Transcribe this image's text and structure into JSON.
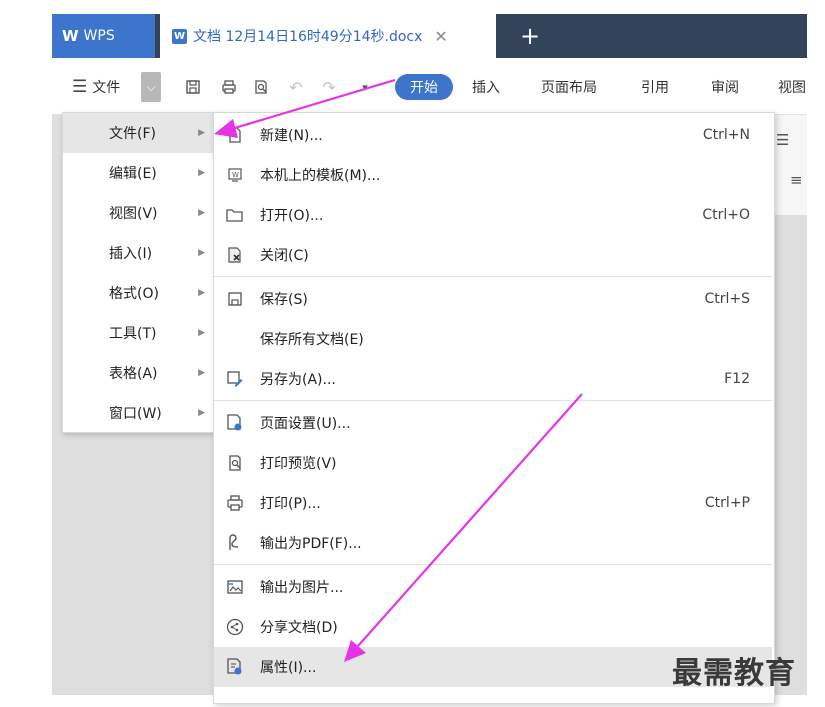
{
  "tabs": {
    "app": "WPS",
    "document": "文档 12月14日16时49分14秒.docx",
    "doc_icon_letter": "W",
    "close": "✕",
    "new": "+"
  },
  "toolbar": {
    "menu_icon": "☰",
    "file_label": "文件",
    "dropdown_icon": "⌵",
    "quick_icons": [
      "save-icon",
      "print-icon",
      "print-preview-icon",
      "undo-icon",
      "redo-icon",
      "customize-icon"
    ],
    "ribbon_tabs": [
      "开始",
      "插入",
      "页面布局",
      "引用",
      "审阅",
      "视图"
    ]
  },
  "left_menu": [
    {
      "label": "文件(F)",
      "active": true
    },
    {
      "label": "编辑(E)"
    },
    {
      "label": "视图(V)"
    },
    {
      "label": "插入(I)"
    },
    {
      "label": "格式(O)"
    },
    {
      "label": "工具(T)"
    },
    {
      "label": "表格(A)"
    },
    {
      "label": "窗口(W)"
    }
  ],
  "file_menu": [
    {
      "label": "新建(N)...",
      "shortcut": "Ctrl+N",
      "icon": "new-document-icon"
    },
    {
      "label": "本机上的模板(M)...",
      "shortcut": "",
      "icon": "template-icon"
    },
    {
      "label": "打开(O)...",
      "shortcut": "Ctrl+O",
      "icon": "open-folder-icon"
    },
    {
      "label": "关闭(C)",
      "shortcut": "",
      "icon": "close-document-icon"
    },
    {
      "label": "保存(S)",
      "shortcut": "Ctrl+S",
      "icon": "save-icon"
    },
    {
      "label": "保存所有文档(E)",
      "shortcut": "",
      "icon": ""
    },
    {
      "label": "另存为(A)...",
      "shortcut": "F12",
      "icon": "save-as-icon"
    },
    {
      "label": "页面设置(U)...",
      "shortcut": "",
      "icon": "page-setup-icon"
    },
    {
      "label": "打印预览(V)",
      "shortcut": "",
      "icon": "print-preview-icon"
    },
    {
      "label": "打印(P)...",
      "shortcut": "Ctrl+P",
      "icon": "print-icon"
    },
    {
      "label": "输出为PDF(F)...",
      "shortcut": "",
      "icon": "export-pdf-icon"
    },
    {
      "label": "输出为图片...",
      "shortcut": "",
      "icon": "export-image-icon"
    },
    {
      "label": "分享文档(D)",
      "shortcut": "",
      "icon": "share-icon"
    },
    {
      "label": "属性(I)...",
      "shortcut": "",
      "icon": "properties-icon",
      "highlighted": true
    }
  ],
  "watermark": "最需教育",
  "colors": {
    "accent": "#3d74cc",
    "titlebar": "#33435a",
    "annotation_arrow": "#e633e6",
    "menu_highlight": "#e6e6e6"
  }
}
